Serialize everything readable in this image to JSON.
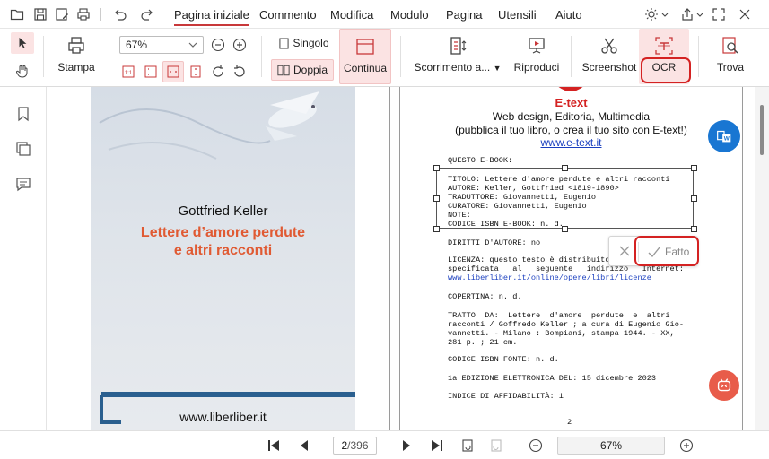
{
  "menubar": {
    "tabs": [
      {
        "label": "Pagina iniziale",
        "active": true
      },
      {
        "label": "Commento"
      },
      {
        "label": "Modifica"
      },
      {
        "label": "Modulo"
      },
      {
        "label": "Pagina"
      },
      {
        "label": "Utensili"
      },
      {
        "label": "Aiuto"
      }
    ],
    "quick_icons": [
      "folder-icon",
      "save-icon",
      "save-as-icon",
      "print-icon",
      "undo-icon",
      "redo-icon"
    ],
    "window_icons": [
      "theme-icon",
      "share-icon",
      "fullscreen-icon",
      "close-icon"
    ]
  },
  "toolbar": {
    "select_tool": "cursor-icon",
    "hand_tool": "hand-icon",
    "stampa_label": "Stampa",
    "zoom_value": "67%",
    "singolo_label": "Singolo",
    "doppia_label": "Doppia",
    "continua_label": "Continua",
    "scorrimento_label": "Scorrimento a...",
    "riproduci_label": "Riproduci",
    "screenshot_label": "Screenshot",
    "ocr_label": "OCR",
    "trova_label": "Trova"
  },
  "left_rail": [
    "bookmark-icon",
    "pages-icon",
    "comment-icon",
    "chevron-down-icon"
  ],
  "document": {
    "cover": {
      "author": "Gottfried Keller",
      "title_line1": "Lettere d’amore perdute",
      "title_line2": "e altri racconti",
      "url": "www.liberliber.it"
    },
    "right_page": {
      "brand": "E-text",
      "line1": "Web design, Editoria, Multimedia",
      "line2": "(pubblica il tuo libro, o crea il tuo sito con E-text!)",
      "link": "www.e-text.it",
      "questo": "QUESTO E-BOOK:",
      "titolo": "TITOLO: Lettere d'amore perdute e altri racconti",
      "autore": "AUTORE: Keller, Gottfried <1819-1890>",
      "traduttore": "TRADUTTORE: Giovannetti, Eugenio",
      "curatore": "CURATORE: Giovannetti, Eugenio",
      "note": "NOTE:",
      "isbn": "CODICE ISBN E-BOOK: n. d.",
      "diritti": "DIRITTI D'AUTORE: no",
      "licenza1": "LICENZA: questo testo è distribuito con la licenza",
      "licenza2": "specificata   al   seguente   indirizzo   Internet:",
      "licenza_link": "www.liberliber.it/online/opere/libri/licenze",
      "copertina": "COPERTINA: n. d.",
      "tratto1": "TRATTO  DA:  Lettere  d'amore  perdute  e  altri",
      "tratto2": "racconti / Goffredo Keller ; a cura di Eugenio Gio-",
      "tratto3": "vannetti. - Milano : Bompiani, stampa 1944. - XX,",
      "tratto4": "281 p. ; 21 cm.",
      "isbn_fonte": "CODICE ISBN FONTE: n. d.",
      "edizione": "1a EDIZIONE ELETTRONICA DEL: 15 dicembre 2023",
      "affidabilita": "INDICE DI AFFIDABILITÀ: 1",
      "page_num": "2"
    },
    "ocr_popup": {
      "cancel_icon": "close-icon",
      "done_label": "Fatto"
    }
  },
  "bottombar": {
    "current_page": "2",
    "total_pages": "/396",
    "zoom": "67%"
  },
  "colors": {
    "accent": "#c8383a",
    "highlight_box": "#d42222",
    "fab_word": "#1976d2",
    "fab_ai": "#e85c4a",
    "cover_title": "#e05a33"
  }
}
